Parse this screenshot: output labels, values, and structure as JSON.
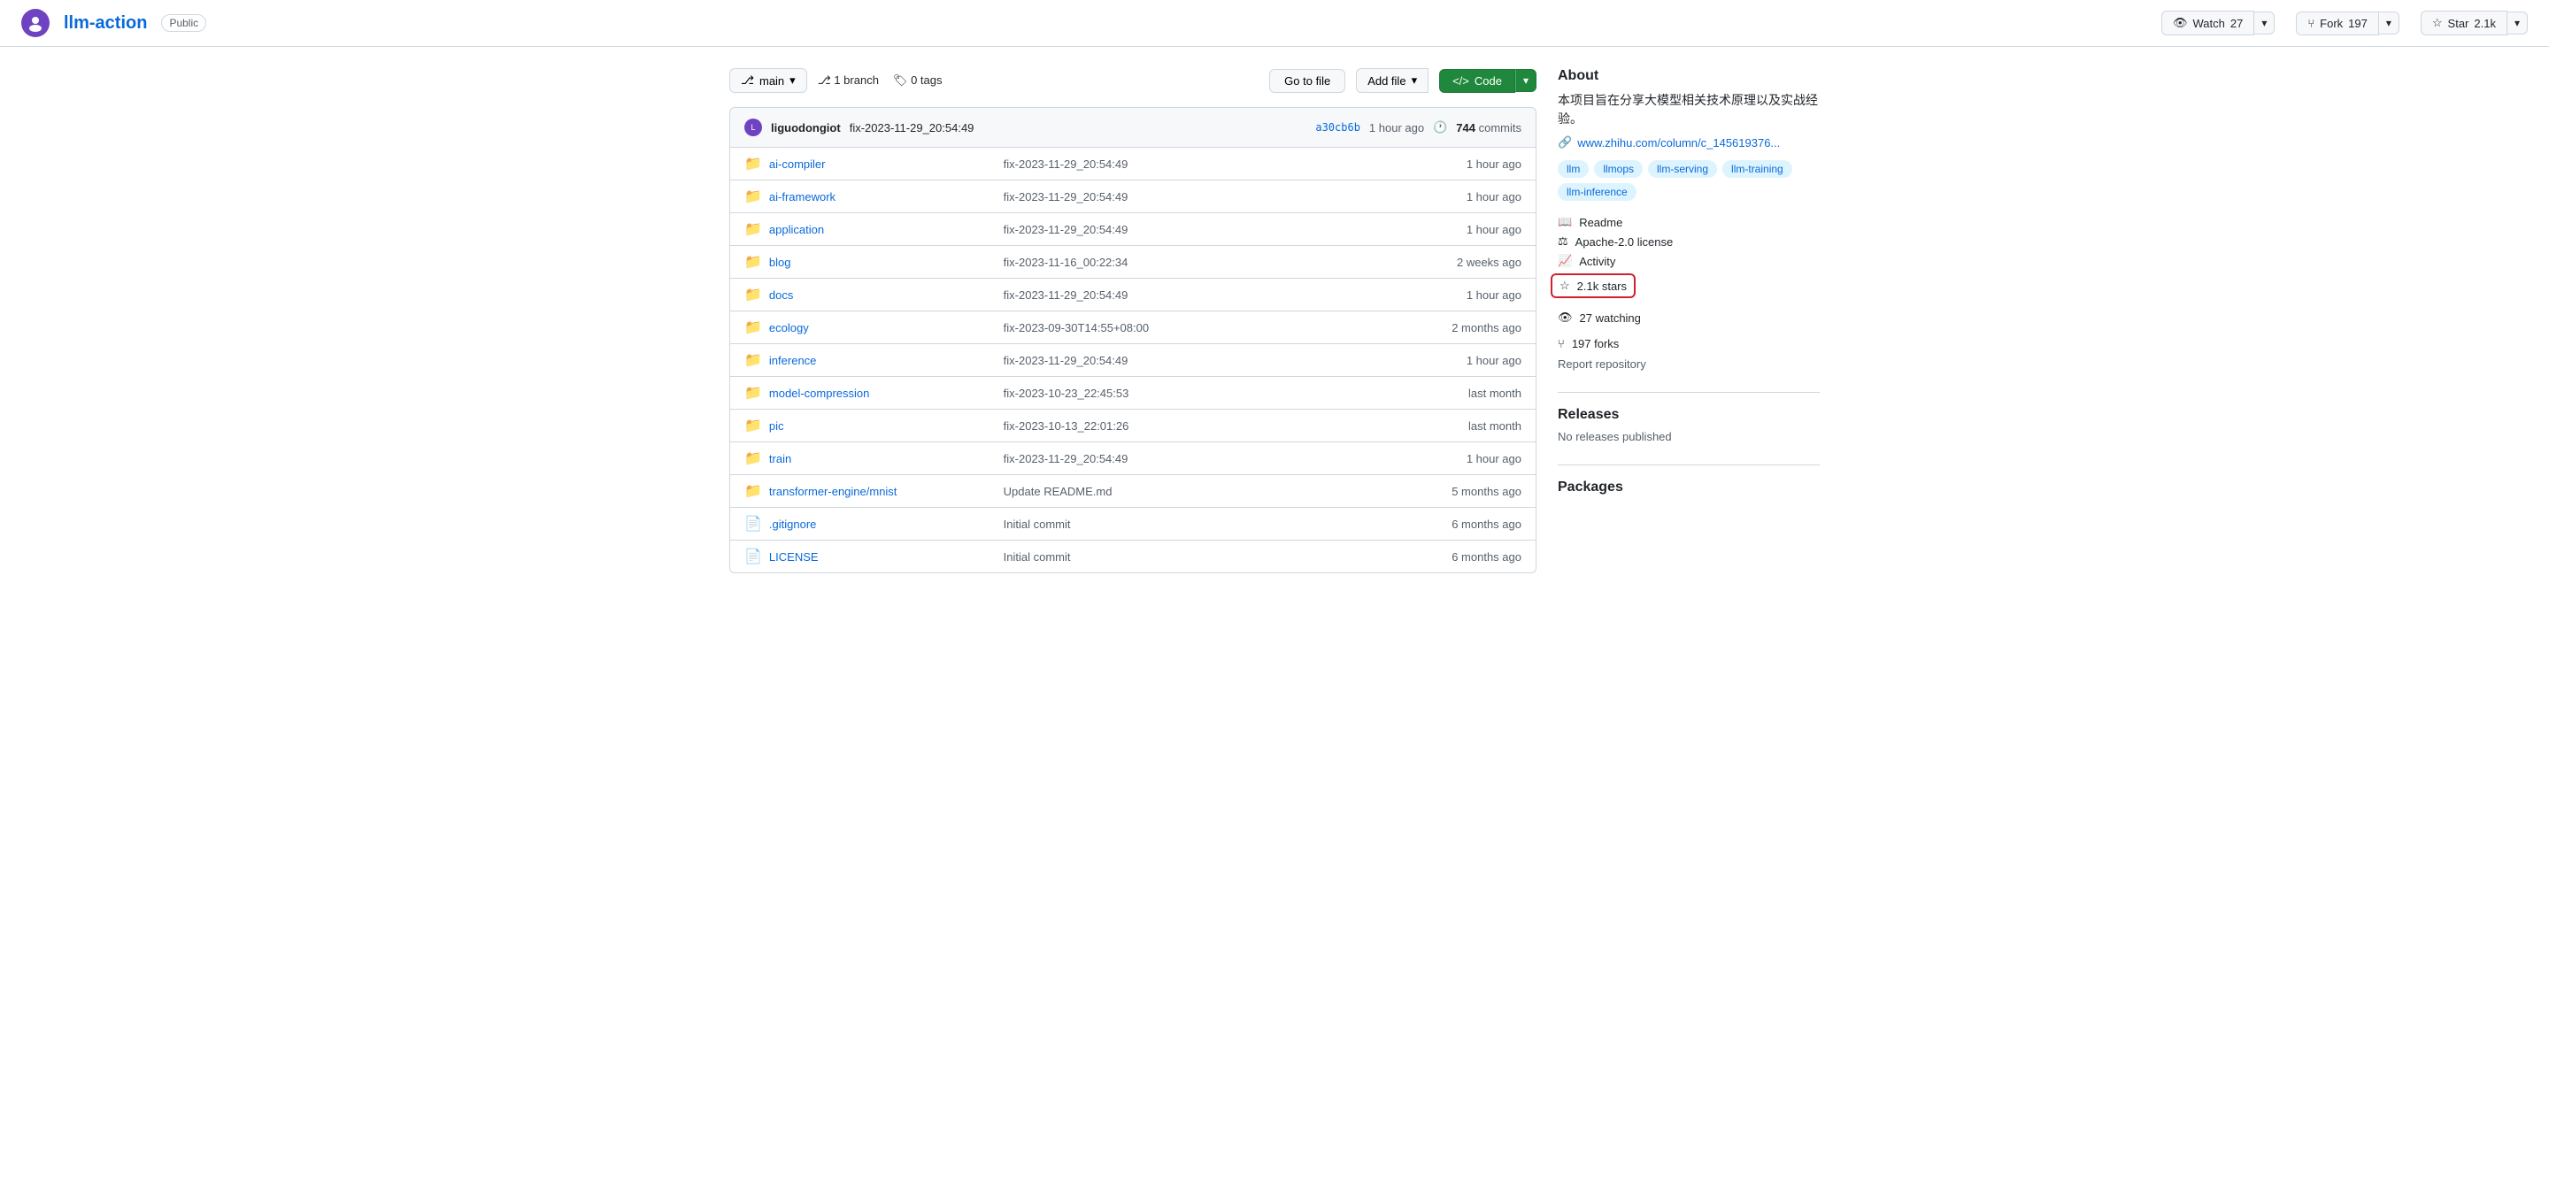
{
  "repo": {
    "avatar_text": "L",
    "name": "llm-action",
    "visibility": "Public",
    "url": "#"
  },
  "actions": {
    "watch_label": "Watch",
    "watch_count": "27",
    "fork_label": "Fork",
    "fork_count": "197",
    "star_label": "Star",
    "star_count": "2.1k"
  },
  "branch_bar": {
    "branch_label": "main",
    "branch_count": "1",
    "branch_text": "branch",
    "tag_count": "0",
    "tag_text": "tags",
    "go_to_file": "Go to file",
    "add_file": "Add file",
    "code_label": "Code"
  },
  "commit_bar": {
    "author": "liguodongiot",
    "message": "fix-2023-11-29_20:54:49",
    "hash": "a30cb6b",
    "time": "1 hour ago",
    "commits_count": "744",
    "commits_label": "commits"
  },
  "files": [
    {
      "type": "folder",
      "name": "ai-compiler",
      "commit": "fix-2023-11-29_20:54:49",
      "time": "1 hour ago"
    },
    {
      "type": "folder",
      "name": "ai-framework",
      "commit": "fix-2023-11-29_20:54:49",
      "time": "1 hour ago"
    },
    {
      "type": "folder",
      "name": "application",
      "commit": "fix-2023-11-29_20:54:49",
      "time": "1 hour ago"
    },
    {
      "type": "folder",
      "name": "blog",
      "commit": "fix-2023-11-16_00:22:34",
      "time": "2 weeks ago"
    },
    {
      "type": "folder",
      "name": "docs",
      "commit": "fix-2023-11-29_20:54:49",
      "time": "1 hour ago"
    },
    {
      "type": "folder",
      "name": "ecology",
      "commit": "fix-2023-09-30T14:55+08:00",
      "time": "2 months ago"
    },
    {
      "type": "folder",
      "name": "inference",
      "commit": "fix-2023-11-29_20:54:49",
      "time": "1 hour ago"
    },
    {
      "type": "folder",
      "name": "model-compression",
      "commit": "fix-2023-10-23_22:45:53",
      "time": "last month"
    },
    {
      "type": "folder",
      "name": "pic",
      "commit": "fix-2023-10-13_22:01:26",
      "time": "last month"
    },
    {
      "type": "folder",
      "name": "train",
      "commit": "fix-2023-11-29_20:54:49",
      "time": "1 hour ago"
    },
    {
      "type": "folder",
      "name": "transformer-engine/mnist",
      "commit": "Update README.md",
      "time": "5 months ago"
    },
    {
      "type": "file",
      "name": ".gitignore",
      "commit": "Initial commit",
      "time": "6 months ago"
    },
    {
      "type": "file",
      "name": "LICENSE",
      "commit": "Initial commit",
      "time": "6 months ago"
    }
  ],
  "about": {
    "title": "About",
    "description": "本项目旨在分享大模型相关技术原理以及实战经验。",
    "link": "www.zhihu.com/column/c_145619376...",
    "tags": [
      "llm",
      "llmops",
      "llm-serving",
      "llm-training",
      "llm-inference"
    ],
    "readme_label": "Readme",
    "license_label": "Apache-2.0 license",
    "activity_label": "Activity",
    "stars_label": "2.1k stars",
    "watching_label": "27 watching",
    "forks_label": "197 forks",
    "report_label": "Report repository"
  },
  "releases": {
    "title": "Releases",
    "empty_text": "No releases published"
  },
  "packages": {
    "title": "Packages"
  }
}
